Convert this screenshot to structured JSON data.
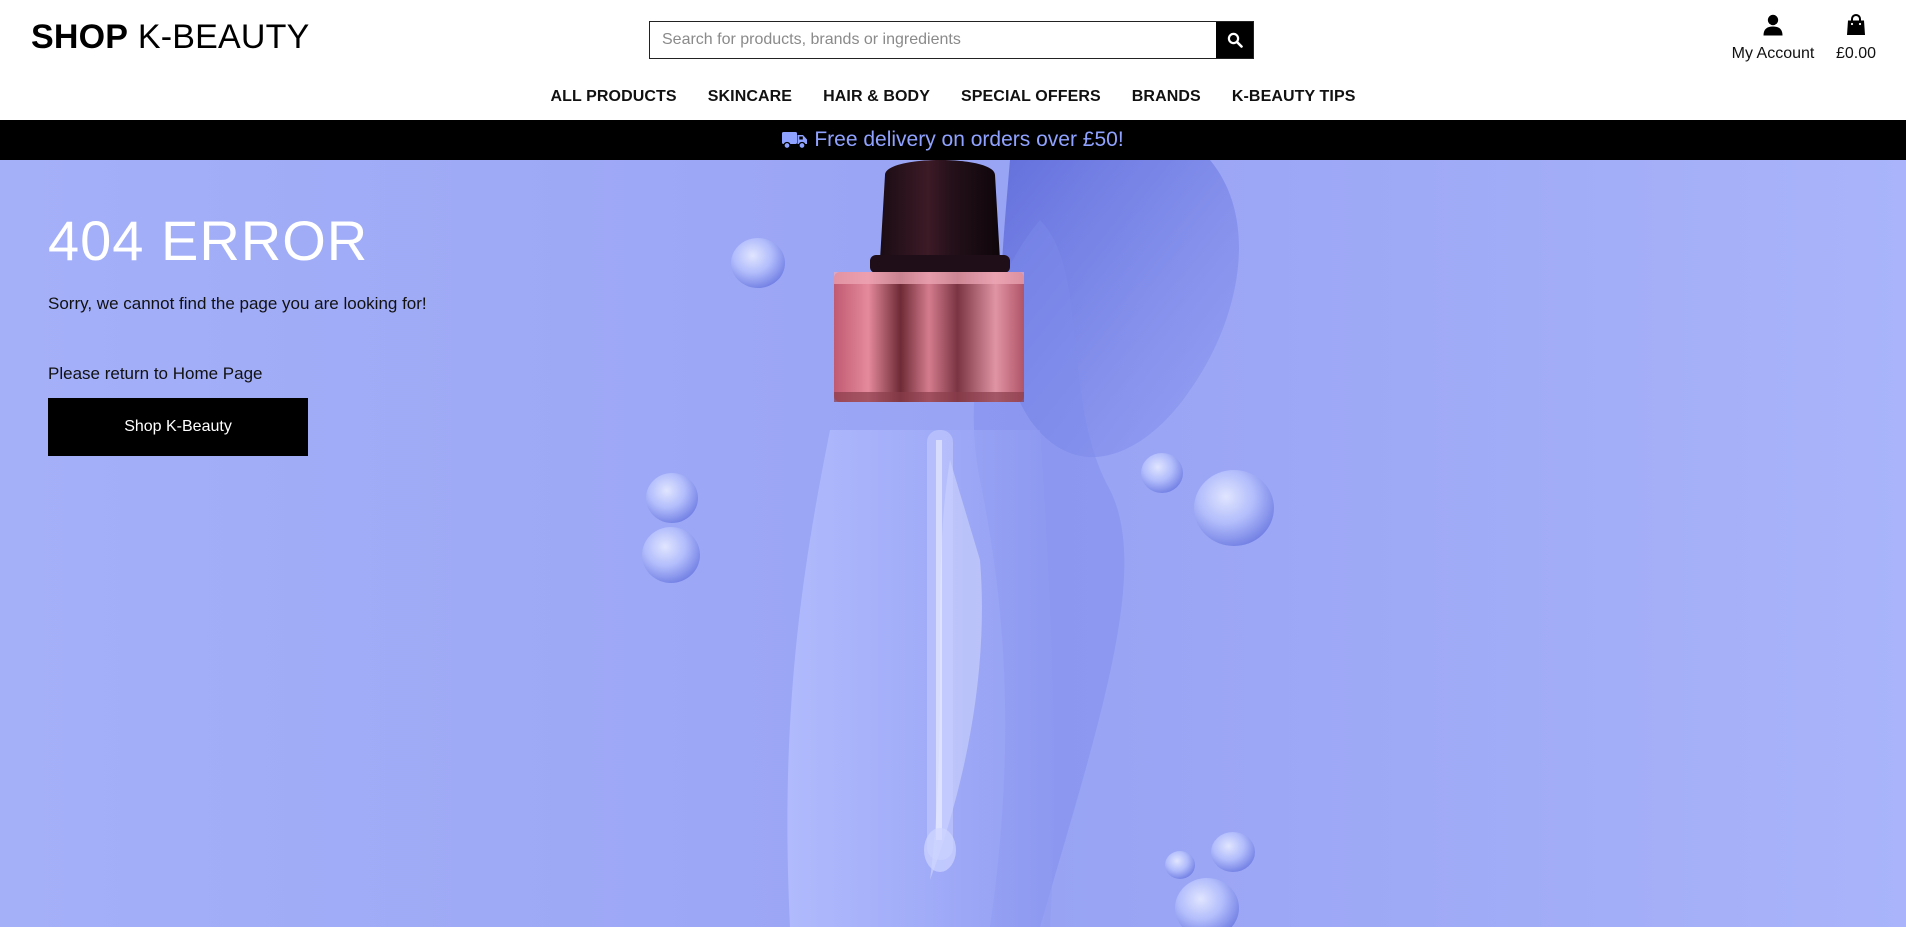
{
  "header": {
    "logo_bold": "SHOP",
    "logo_light": "K-BEAUTY",
    "search_placeholder": "Search for products, brands or ingredients",
    "account_label": "My Account",
    "bag_total": "£0.00"
  },
  "nav": {
    "items": [
      "ALL PRODUCTS",
      "SKINCARE",
      "HAIR & BODY",
      "SPECIAL OFFERS",
      "BRANDS",
      "K-BEAUTY TIPS"
    ]
  },
  "banner": {
    "text": "Free delivery on orders over £50!",
    "icon": "truck-icon",
    "text_color": "#8fa2ff"
  },
  "hero": {
    "title": "404 ERROR",
    "message": "Sorry, we cannot find the page you are looking for!",
    "return_text": "Please return to Home Page",
    "button_label": "Shop K-Beauty",
    "background_color": "#9ea9f6"
  },
  "colors": {
    "primary": "#000000",
    "accent": "#8fa2ff",
    "hero": "#9ea9f6"
  }
}
